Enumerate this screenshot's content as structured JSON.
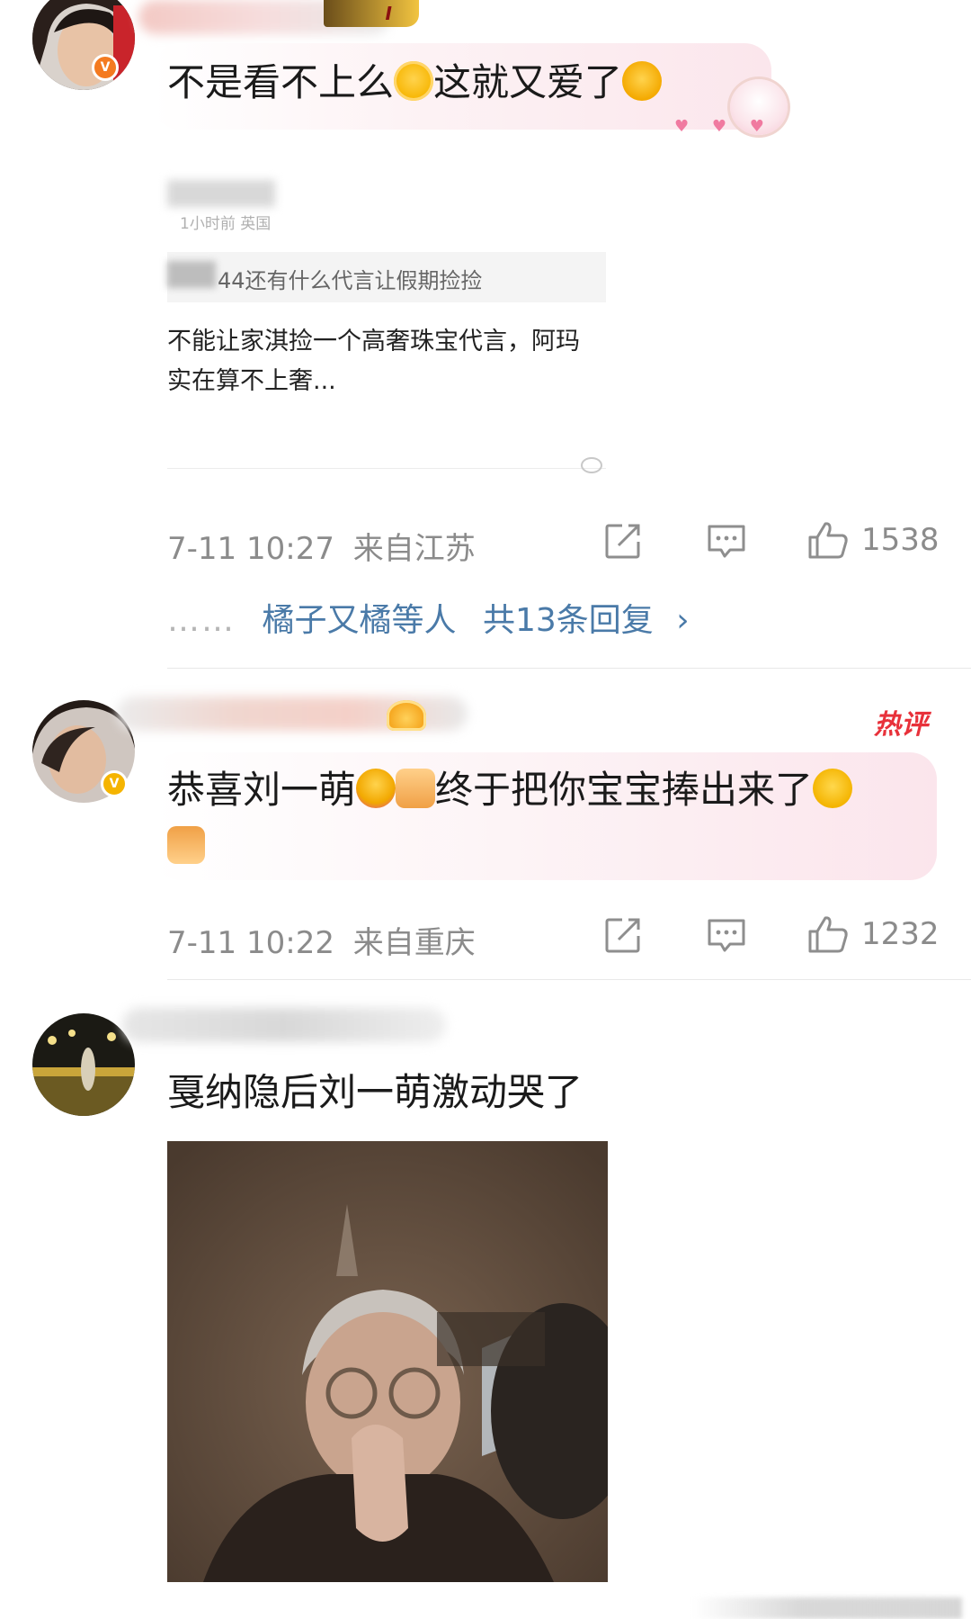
{
  "comments": [
    {
      "text": "不是看不上么",
      "text2": "这就又爱了",
      "time": "7-11 10:27",
      "location": "来自江苏",
      "likes": "1538",
      "quote": {
        "small": "1小时前 英国",
        "strip": "44还有什么代言让假期捡捡",
        "body": "不能让家淇捡一个高奢珠宝代言，阿玛\n实在算不上奢..."
      },
      "replies": {
        "dots": "……",
        "names": "橘子又橘",
        "suffix": "等人",
        "total": "共13条回复",
        "chevron": "›"
      }
    },
    {
      "text": "恭喜刘一萌",
      "text2": "终于把你宝宝捧出来了",
      "hot_tag": "热评",
      "time": "7-11 10:22",
      "location": "来自重庆",
      "likes": "1232"
    },
    {
      "text": "戛纳隐后刘一萌激动哭了"
    }
  ],
  "icons": {
    "share": "share-icon",
    "comment": "comment-icon",
    "like": "thumbs-up-icon"
  },
  "colors": {
    "link": "#4a7aa8",
    "meta": "#8b8b8b",
    "hot": "#e8313a",
    "verified_orange": "#f47a20",
    "verified_yellow": "#f5b400"
  }
}
